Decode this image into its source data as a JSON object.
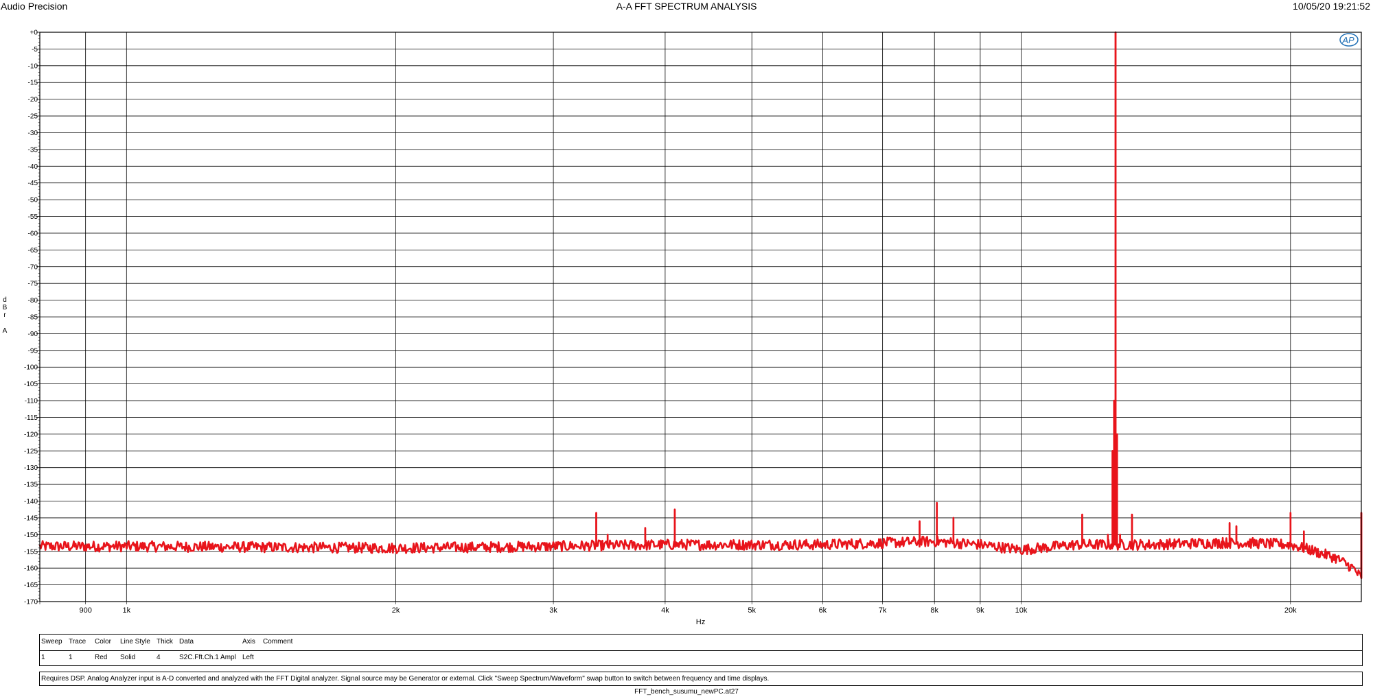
{
  "header": {
    "brand": "Audio Precision",
    "title": "A-A FFT SPECTRUM ANALYSIS",
    "timestamp": "10/05/20 19:21:52"
  },
  "logo_text": "AP",
  "colors": {
    "trace": "#e8141b",
    "grid": "#000000",
    "logo": "#1f6fb5"
  },
  "chart_data": {
    "type": "line",
    "title": "A-A FFT SPECTRUM ANALYSIS",
    "xlabel": "Hz",
    "ylabel": "dBrA",
    "x_scale": "log",
    "xlim": [
      800,
      24000
    ],
    "ylim": [
      -170,
      0
    ],
    "y_ticks": [
      "+0",
      "-5",
      "-10",
      "-15",
      "-20",
      "-25",
      "-30",
      "-35",
      "-40",
      "-45",
      "-50",
      "-55",
      "-60",
      "-65",
      "-70",
      "-75",
      "-80",
      "-85",
      "-90",
      "-95",
      "-100",
      "-105",
      "-110",
      "-115",
      "-120",
      "-125",
      "-130",
      "-135",
      "-140",
      "-145",
      "-150",
      "-155",
      "-160",
      "-165",
      "-170"
    ],
    "x_ticks": [
      {
        "value": 900,
        "label": "900"
      },
      {
        "value": 1000,
        "label": "1k"
      },
      {
        "value": 2000,
        "label": "2k"
      },
      {
        "value": 3000,
        "label": "3k"
      },
      {
        "value": 4000,
        "label": "4k"
      },
      {
        "value": 5000,
        "label": "5k"
      },
      {
        "value": 6000,
        "label": "6k"
      },
      {
        "value": 7000,
        "label": "7k"
      },
      {
        "value": 8000,
        "label": "8k"
      },
      {
        "value": 9000,
        "label": "9k"
      },
      {
        "value": 10000,
        "label": "10k"
      },
      {
        "value": 20000,
        "label": "20k"
      }
    ],
    "grid": true,
    "series": [
      {
        "color": "#e8141b",
        "noise_floor": [
          [
            800,
            -153.5
          ],
          [
            1000,
            -153.5
          ],
          [
            2000,
            -154
          ],
          [
            3000,
            -153.5
          ],
          [
            4000,
            -153
          ],
          [
            5000,
            -153
          ],
          [
            6000,
            -153
          ],
          [
            7000,
            -152.5
          ],
          [
            8000,
            -152
          ],
          [
            9000,
            -153
          ],
          [
            10000,
            -154.5
          ],
          [
            11500,
            -153
          ],
          [
            14000,
            -153
          ],
          [
            16000,
            -152.5
          ],
          [
            18000,
            -152.5
          ],
          [
            20000,
            -153
          ],
          [
            21000,
            -154.5
          ],
          [
            22500,
            -157
          ],
          [
            23500,
            -160
          ],
          [
            24000,
            -163
          ]
        ],
        "spurs": [
          [
            3350,
            -143.5
          ],
          [
            3450,
            -150
          ],
          [
            3800,
            -148
          ],
          [
            4100,
            -142.5
          ],
          [
            7700,
            -146
          ],
          [
            8050,
            -140.5
          ],
          [
            8400,
            -145
          ],
          [
            11700,
            -144
          ],
          [
            12500,
            -150
          ],
          [
            12650,
            -125
          ],
          [
            12700,
            -110
          ],
          [
            12750,
            0
          ],
          [
            12800,
            -120
          ],
          [
            12900,
            -150
          ],
          [
            13300,
            -144
          ],
          [
            16800,
            -151
          ],
          [
            17100,
            -146.5
          ],
          [
            17400,
            -147.5
          ],
          [
            20000,
            -143.5
          ],
          [
            20700,
            -149
          ],
          [
            24000,
            -143.5
          ]
        ]
      }
    ]
  },
  "legend": {
    "headers": [
      "Sweep",
      "Trace",
      "Color",
      "Line Style",
      "Thick",
      "Data",
      "Axis",
      "Comment"
    ],
    "rows": [
      [
        "1",
        "1",
        "Red",
        "Solid",
        "4",
        "S2C.Fft.Ch.1 Ampl",
        "Left",
        ""
      ]
    ]
  },
  "note": "Requires DSP.  Analog Analyzer input is A-D converted and analyzed with the FFT Digital analyzer.  Signal source may be Generator or external.  Click \"Sweep Spectrum/Waveform\" swap button to switch between frequency and time displays.",
  "footer": "FFT_bench_susumu_newPC.at27"
}
